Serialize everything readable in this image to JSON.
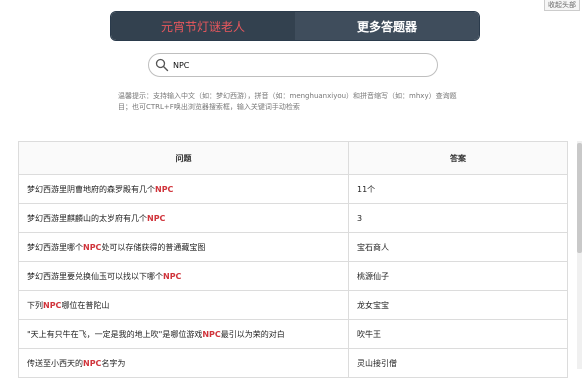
{
  "top_link": "收起头部",
  "tabs": [
    {
      "label": "元宵节灯谜老人",
      "active": true
    },
    {
      "label": "更多答题器",
      "active": false
    }
  ],
  "search": {
    "value": "NPC",
    "placeholder": ""
  },
  "hint": "温馨提示：支持输入中文（如：梦幻西游），拼音（如：menghuanxiyou）和拼音缩写（如：mhxy）查询题目；也可CTRL+F唤出浏览器搜索框，输入关键词手动检索",
  "table": {
    "headers": [
      "问题",
      "答案"
    ],
    "rows": [
      {
        "q_pre": "梦幻西游里阴曹地府的森罗殿有几个",
        "q_hl": "NPC",
        "q_post": "",
        "a": "11个"
      },
      {
        "q_pre": "梦幻西游里麒麟山的太岁府有几个",
        "q_hl": "NPC",
        "q_post": "",
        "a": "3"
      },
      {
        "q_pre": "梦幻西游里哪个",
        "q_hl": "NPC",
        "q_post": "处可以存储获得的普通藏宝图",
        "a": "宝石商人"
      },
      {
        "q_pre": "梦幻西游里要兑换仙玉可以找以下哪个",
        "q_hl": "NPC",
        "q_post": "",
        "a": "桃源仙子"
      },
      {
        "q_pre": "下列",
        "q_hl": "NPC",
        "q_post": "哪位在普陀山",
        "a": "龙女宝宝"
      },
      {
        "q_pre": "\"天上有只牛在飞，一定是我的地上吹\"是哪位游戏",
        "q_hl": "NPC",
        "q_post": "最引以为荣的对白",
        "a": "吹牛王"
      },
      {
        "q_pre": "传送至小西天的",
        "q_hl": "NPC",
        "q_post": "名字为",
        "a": "灵山接引僧"
      }
    ]
  }
}
